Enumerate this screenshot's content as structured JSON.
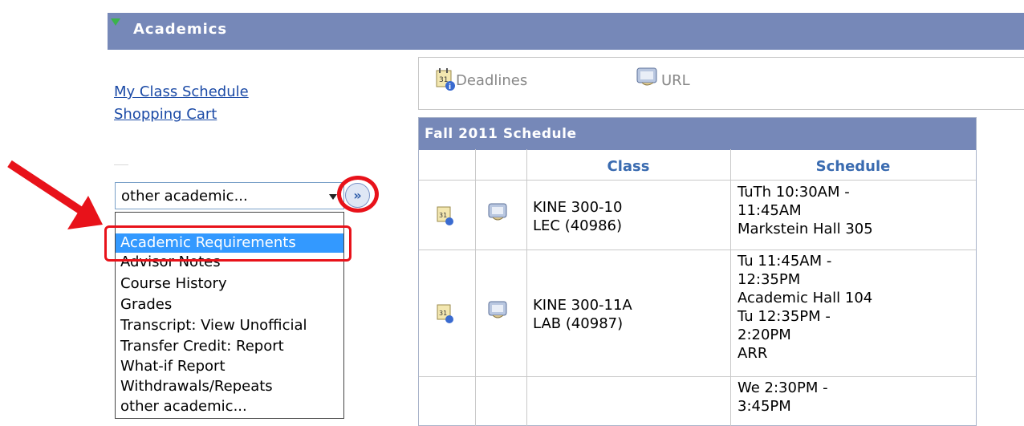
{
  "header": {
    "title": "Academics"
  },
  "links": [
    {
      "label": "My Class Schedule"
    },
    {
      "label": "Shopping Cart"
    }
  ],
  "select": {
    "value": "other academic...",
    "options": [
      "Academic Requirements",
      "Advisor Notes",
      "Course History",
      "Grades",
      "Transcript: View Unofficial",
      "Transfer Credit: Report",
      "What-if Report",
      "Withdrawals/Repeats",
      "other academic..."
    ],
    "highlighted": "Academic Requirements"
  },
  "go_button": {
    "glyph": "»"
  },
  "toolbar": {
    "deadlines_label": "Deadlines",
    "url_label": "URL"
  },
  "schedule": {
    "title": "Fall 2011 Schedule",
    "columns": [
      "Class",
      "Schedule"
    ],
    "rows": [
      {
        "class_lines": [
          "KINE 300-10",
          "LEC (40986)"
        ],
        "schedule_lines": [
          "TuTh 10:30AM -",
          "11:45AM",
          "Markstein Hall 305"
        ]
      },
      {
        "class_lines": [
          "KINE 300-11A",
          "LAB (40987)"
        ],
        "schedule_lines": [
          "Tu 11:45AM -",
          "12:35PM",
          "Academic Hall 104",
          "Tu 12:35PM -",
          "2:20PM",
          "ARR"
        ]
      },
      {
        "class_lines": [],
        "schedule_lines": [
          "We 2:30PM -",
          "3:45PM"
        ]
      }
    ]
  },
  "colors": {
    "header_bg": "#7688b8",
    "link": "#1b4aa6",
    "highlight": "#3399ff",
    "annotation_red": "#e8121a"
  }
}
